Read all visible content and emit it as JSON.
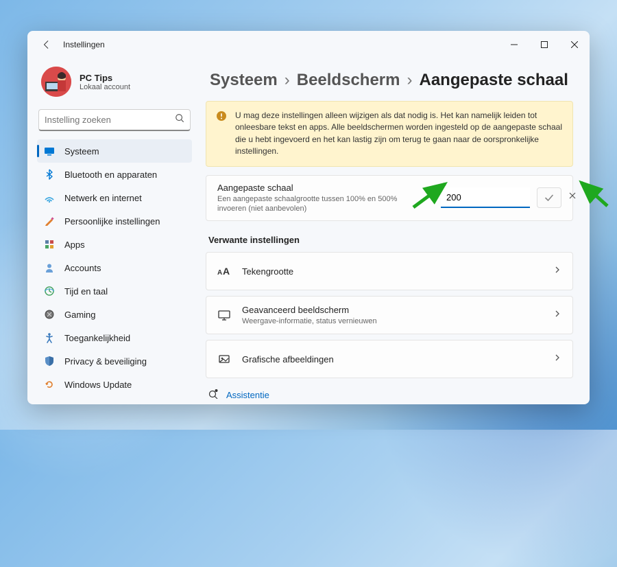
{
  "app": {
    "title": "Instellingen"
  },
  "profile": {
    "name": "PC Tips",
    "subtitle": "Lokaal account"
  },
  "search": {
    "placeholder": "Instelling zoeken"
  },
  "nav": {
    "items": [
      {
        "label": "Systeem"
      },
      {
        "label": "Bluetooth en apparaten"
      },
      {
        "label": "Netwerk en internet"
      },
      {
        "label": "Persoonlijke instellingen"
      },
      {
        "label": "Apps"
      },
      {
        "label": "Accounts"
      },
      {
        "label": "Tijd en taal"
      },
      {
        "label": "Gaming"
      },
      {
        "label": "Toegankelijkheid"
      },
      {
        "label": "Privacy & beveiliging"
      },
      {
        "label": "Windows Update"
      }
    ]
  },
  "breadcrumb": {
    "l1": "Systeem",
    "l2": "Beeldscherm",
    "l3": "Aangepaste schaal",
    "sep": "›"
  },
  "warning": {
    "text": "U mag deze instellingen alleen wijzigen als dat nodig is. Het kan namelijk leiden tot onleesbare tekst en apps. Alle beeldschermen worden ingesteld op de aangepaste schaal die u hebt ingevoerd en het kan lastig zijn om terug te gaan naar de oorspronkelijke instellingen."
  },
  "scale": {
    "title": "Aangepaste schaal",
    "subtitle": "Een aangepaste schaalgrootte tussen 100% en 500% invoeren (niet aanbevolen)",
    "value": "200"
  },
  "related": {
    "heading": "Verwante instellingen",
    "items": [
      {
        "title": "Tekengrootte",
        "subtitle": ""
      },
      {
        "title": "Geavanceerd beeldscherm",
        "subtitle": "Weergave-informatie, status vernieuwen"
      },
      {
        "title": "Grafische afbeeldingen",
        "subtitle": ""
      }
    ]
  },
  "help": {
    "label": "Assistentie"
  }
}
